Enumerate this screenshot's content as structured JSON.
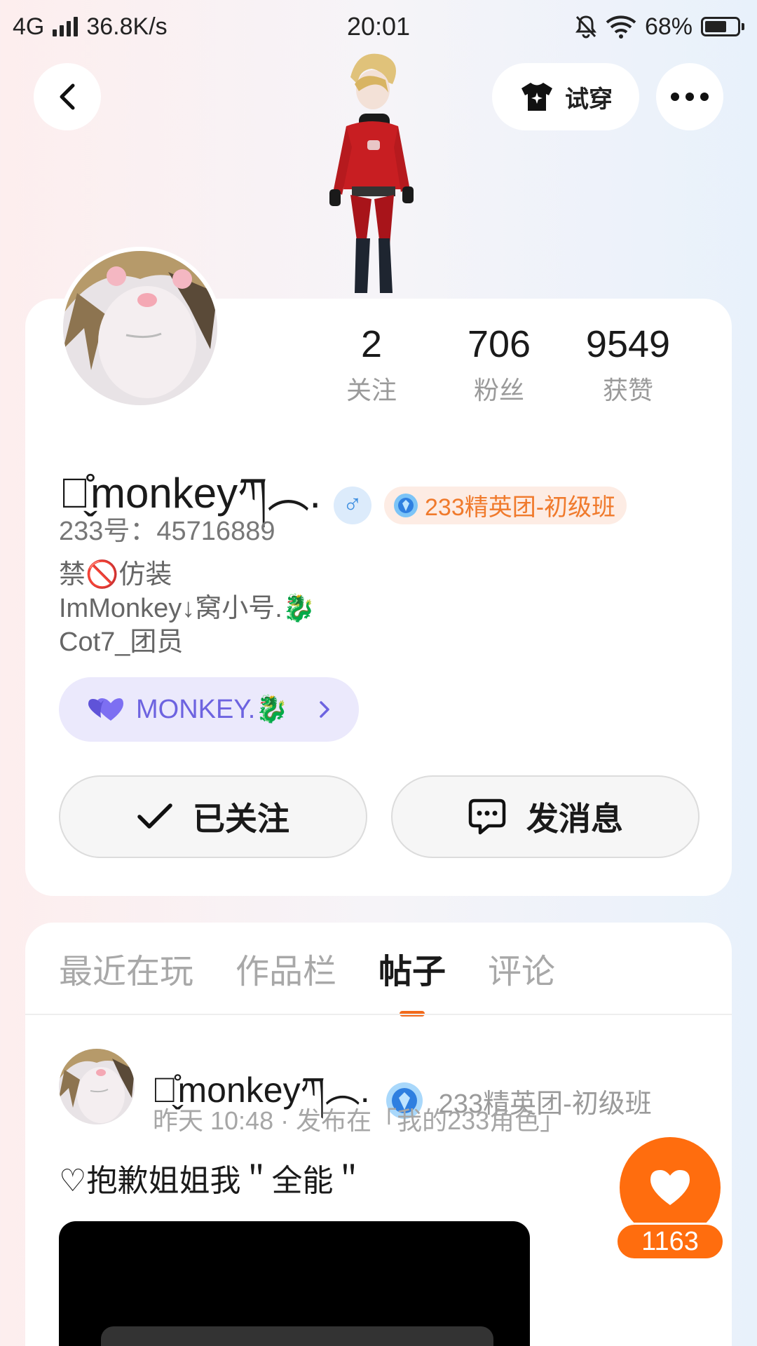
{
  "status_bar": {
    "network": "4G",
    "speed": "36.8K/s",
    "time": "20:01",
    "battery": "68%",
    "battery_level": 0.68
  },
  "header": {
    "tryon_label": "试穿"
  },
  "profile": {
    "stats": [
      {
        "num": "2",
        "label": "关注"
      },
      {
        "num": "706",
        "label": "粉丝"
      },
      {
        "num": "9549",
        "label": "获赞"
      }
    ],
    "username": "ฝ̬̊monkeyཀ︵.",
    "gender_symbol": "♂",
    "elite_badge": "233精英团-初级班",
    "id_line": "233号：45716889",
    "bio_lines": [
      "禁🚫仿装",
      "ImMonkey↓窝小号.🐉",
      "Cot7_团员"
    ],
    "group_pill": "MONKEY.🐉",
    "follow_label": "已关注",
    "message_label": "发消息"
  },
  "tabs": [
    "最近在玩",
    "作品栏",
    "帖子",
    "评论"
  ],
  "post": {
    "username": "ฝ̬̊monkeyཀ︵.",
    "elite_badge": "233精英团-初级班",
    "meta": "昨天 10:48 · 发布在「我的233角色」",
    "title": "♡抱歉姐姐我＂全能＂"
  },
  "like": {
    "count": "1163"
  },
  "colors": {
    "accent": "#f26a1b",
    "like": "#ff6d0e",
    "group_text": "#6d63e0"
  }
}
